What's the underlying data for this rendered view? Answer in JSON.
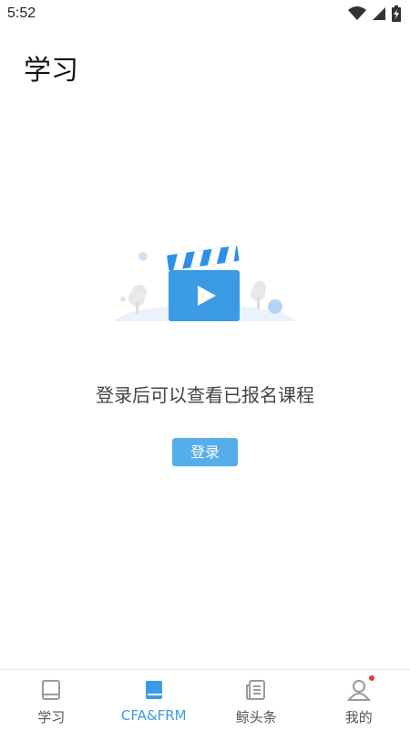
{
  "status_bar": {
    "time": "5:52",
    "icons": [
      "wifi-icon",
      "cellular-signal-icon",
      "battery-charging-icon"
    ]
  },
  "header": {
    "title": "学习"
  },
  "empty_state": {
    "illustration": "video-clapperboard-icon",
    "message": "登录后可以查看已报名课程",
    "login_label": "登录"
  },
  "bottom_nav": {
    "items": [
      {
        "label": "学习",
        "icon": "book-icon",
        "active": false
      },
      {
        "label": "CFA&FRM",
        "icon": "book-filled-icon",
        "active": true
      },
      {
        "label": "鲸头条",
        "icon": "news-icon",
        "active": false
      },
      {
        "label": "我的",
        "icon": "user-icon",
        "active": false,
        "badge": true
      }
    ]
  },
  "colors": {
    "accent": "#3a9be4",
    "button": "#55ade9",
    "badge": "#e53935"
  }
}
